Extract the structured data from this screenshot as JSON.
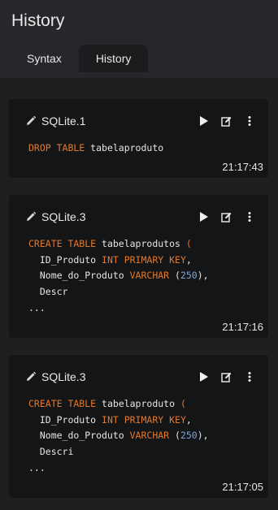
{
  "panel": {
    "title": "History"
  },
  "tabs": [
    {
      "label": "Syntax",
      "active": false
    },
    {
      "label": "History",
      "active": true
    }
  ],
  "entries": [
    {
      "database": "SQLite.1",
      "time": "21:17:43",
      "lines": [
        [
          {
            "t": "DROP TABLE",
            "k": "kw"
          },
          {
            "t": " tabelaproduto",
            "k": ""
          }
        ]
      ]
    },
    {
      "database": "SQLite.3",
      "time": "21:17:16",
      "lines": [
        [
          {
            "t": "CREATE TABLE",
            "k": "kw"
          },
          {
            "t": " tabelaprodutos ",
            "k": ""
          },
          {
            "t": "(",
            "k": "kw"
          }
        ],
        [
          {
            "t": "  ID_Produto ",
            "k": ""
          },
          {
            "t": "INT PRIMARY KEY",
            "k": "kw"
          },
          {
            "t": ",",
            "k": ""
          }
        ],
        [
          {
            "t": "  Nome_do_Produto ",
            "k": ""
          },
          {
            "t": "VARCHAR",
            "k": "kw"
          },
          {
            "t": " (",
            "k": ""
          },
          {
            "t": "250",
            "k": "num"
          },
          {
            "t": "),",
            "k": ""
          }
        ],
        [
          {
            "t": "  Descr",
            "k": ""
          }
        ],
        [
          {
            "t": "...",
            "k": ""
          }
        ]
      ]
    },
    {
      "database": "SQLite.3",
      "time": "21:17:05",
      "lines": [
        [
          {
            "t": "CREATE TABLE",
            "k": "kw"
          },
          {
            "t": " tabelaproduto ",
            "k": ""
          },
          {
            "t": "(",
            "k": "kw"
          }
        ],
        [
          {
            "t": "  ID_Produto ",
            "k": ""
          },
          {
            "t": "INT PRIMARY KEY",
            "k": "kw"
          },
          {
            "t": ",",
            "k": ""
          }
        ],
        [
          {
            "t": "  Nome_do_Produto ",
            "k": ""
          },
          {
            "t": "VARCHAR",
            "k": "kw"
          },
          {
            "t": " (",
            "k": ""
          },
          {
            "t": "250",
            "k": "num"
          },
          {
            "t": "),",
            "k": ""
          }
        ],
        [
          {
            "t": "  Descri",
            "k": ""
          }
        ],
        [
          {
            "t": "...",
            "k": ""
          }
        ]
      ]
    }
  ],
  "icons": {
    "edit_name": "pencil-icon",
    "run": "play-icon",
    "open_editor": "edit-in-editor-icon",
    "more": "more-vertical-icon"
  },
  "colors": {
    "keyword": "#e1792f",
    "number": "#7aa6d8",
    "background": "#1e1f21",
    "card": "#141517"
  }
}
